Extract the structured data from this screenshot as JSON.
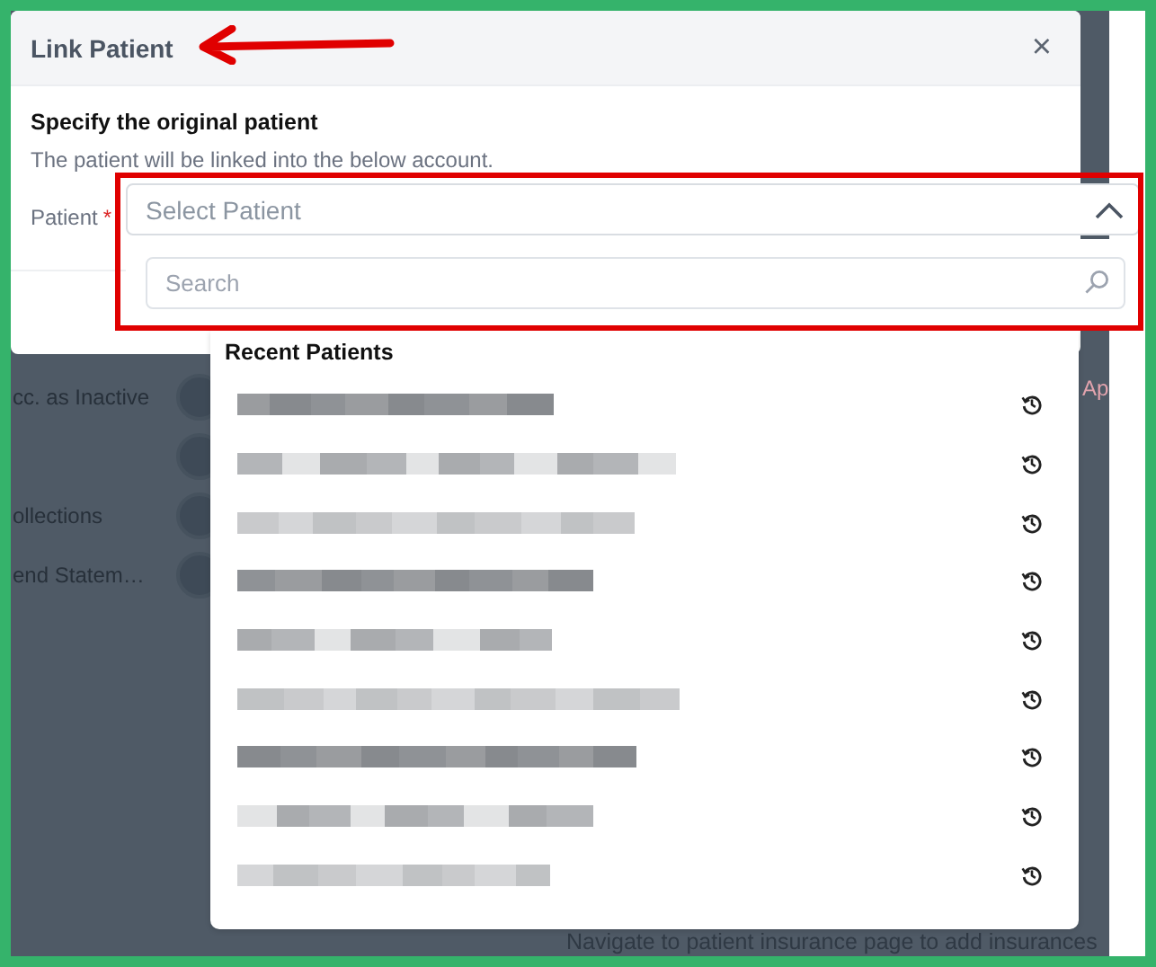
{
  "background": {
    "rows": [
      {
        "label": "cc. as Inactive",
        "on": false
      },
      {
        "label": "",
        "on": false
      },
      {
        "label": "ollections",
        "on": false
      },
      {
        "label": "end Statem…",
        "on": false
      }
    ],
    "side_link": "Ap",
    "footer_note": "Navigate to patient insurance page to add insurances"
  },
  "dialog": {
    "title": "Link Patient",
    "close": "×",
    "heading": "Specify the original patient",
    "description": "The patient will be linked into the below account.",
    "field_label": "Patient",
    "required_mark": "*"
  },
  "select": {
    "placeholder": "Select Patient",
    "expanded": true
  },
  "search": {
    "placeholder": "Search"
  },
  "recent_patients": {
    "heading": "Recent Patients",
    "items": [
      {
        "kind": "redacted"
      },
      {
        "kind": "redacted"
      },
      {
        "kind": "redacted"
      },
      {
        "kind": "redacted"
      },
      {
        "kind": "redacted"
      },
      {
        "kind": "redacted"
      },
      {
        "kind": "redacted"
      },
      {
        "kind": "redacted"
      },
      {
        "kind": "redacted"
      }
    ]
  }
}
